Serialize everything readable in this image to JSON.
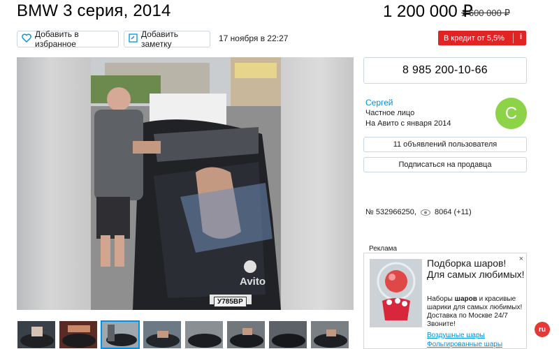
{
  "listing": {
    "title": "BMW 3 серия, 2014",
    "price": "1 200 000 ₽",
    "old_price": "1 600 000 ₽",
    "date": "17 ноября в 22:27",
    "id": "№ 532966250,",
    "views": "8064 (+11)",
    "plate_text": "У785ВР",
    "watermark": "Avito"
  },
  "actions": {
    "favorite_label": "Добавить в избранное",
    "note_label": "Добавить заметку",
    "credit_label": "В кредит от 5,5%",
    "credit_info": "i"
  },
  "contact": {
    "phone": "8 985 200-10-66"
  },
  "seller": {
    "name": "Сергей",
    "type": "Частное лицо",
    "since": "На Авито с января 2014",
    "avatar_letter": "С",
    "avatar_color": "#8cd348",
    "listings_button": "11 объявлений пользователя",
    "subscribe_button": "Подписаться на продавца"
  },
  "ad": {
    "label": "Реклама",
    "title": "Подборка шаров! Для самых любимых!",
    "text_before": "Наборы ",
    "text_bold": "шаров",
    "text_after": " и красивые шарики для самых любимых! Доставка по Москве 24/7 Звоните!",
    "link1": "Воздушные шары",
    "link2": "Фольгированные шары",
    "close": "×"
  },
  "colors": {
    "accent_link": "#0091d9",
    "credit_red": "#e02424",
    "border": "#c9d6e4"
  },
  "badge": {
    "text": "ru"
  }
}
